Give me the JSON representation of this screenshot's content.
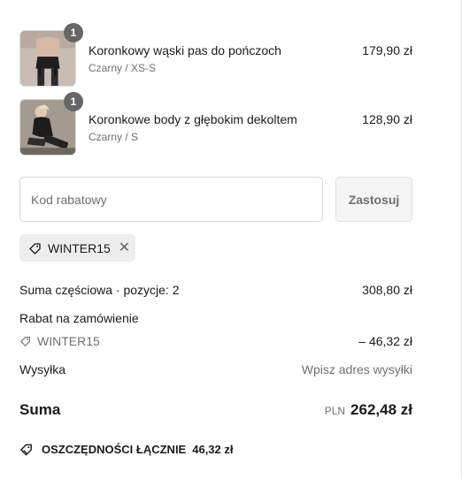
{
  "line_items": [
    {
      "title": "Koronkowy wąski pas do pończoch",
      "variant": "Czarny / XS-S",
      "price": "179,90 zł",
      "quantity": "1"
    },
    {
      "title": "Koronkowe body z głębokim dekoltem",
      "variant": "Czarny / S",
      "price": "128,90 zł",
      "quantity": "1"
    }
  ],
  "discount": {
    "placeholder": "Kod rabatowy",
    "apply_label": "Zastosuj",
    "applied_code": "WINTER15"
  },
  "summary": {
    "subtotal_label": "Suma częściowa · pozycje: 2",
    "subtotal_value": "308,80 zł",
    "order_discount_label": "Rabat na zamówienie",
    "order_discount_code": "WINTER15",
    "order_discount_value": "– 46,32 zł",
    "shipping_label": "Wysyłka",
    "shipping_value": "Wpisz adres wysyłki",
    "total_label": "Suma",
    "total_currency": "PLN",
    "total_value": "262,48 zł",
    "savings_label": "OSZCZĘDNOŚCI ŁĄCZNIE",
    "savings_value": "46,32 zł"
  },
  "icons": {
    "tag": "tag-icon",
    "remove": "close-icon",
    "savings": "discount-tag-icon"
  },
  "colors": {
    "badge": "#666666",
    "chip_background": "#ededed",
    "muted_text": "#707070"
  }
}
